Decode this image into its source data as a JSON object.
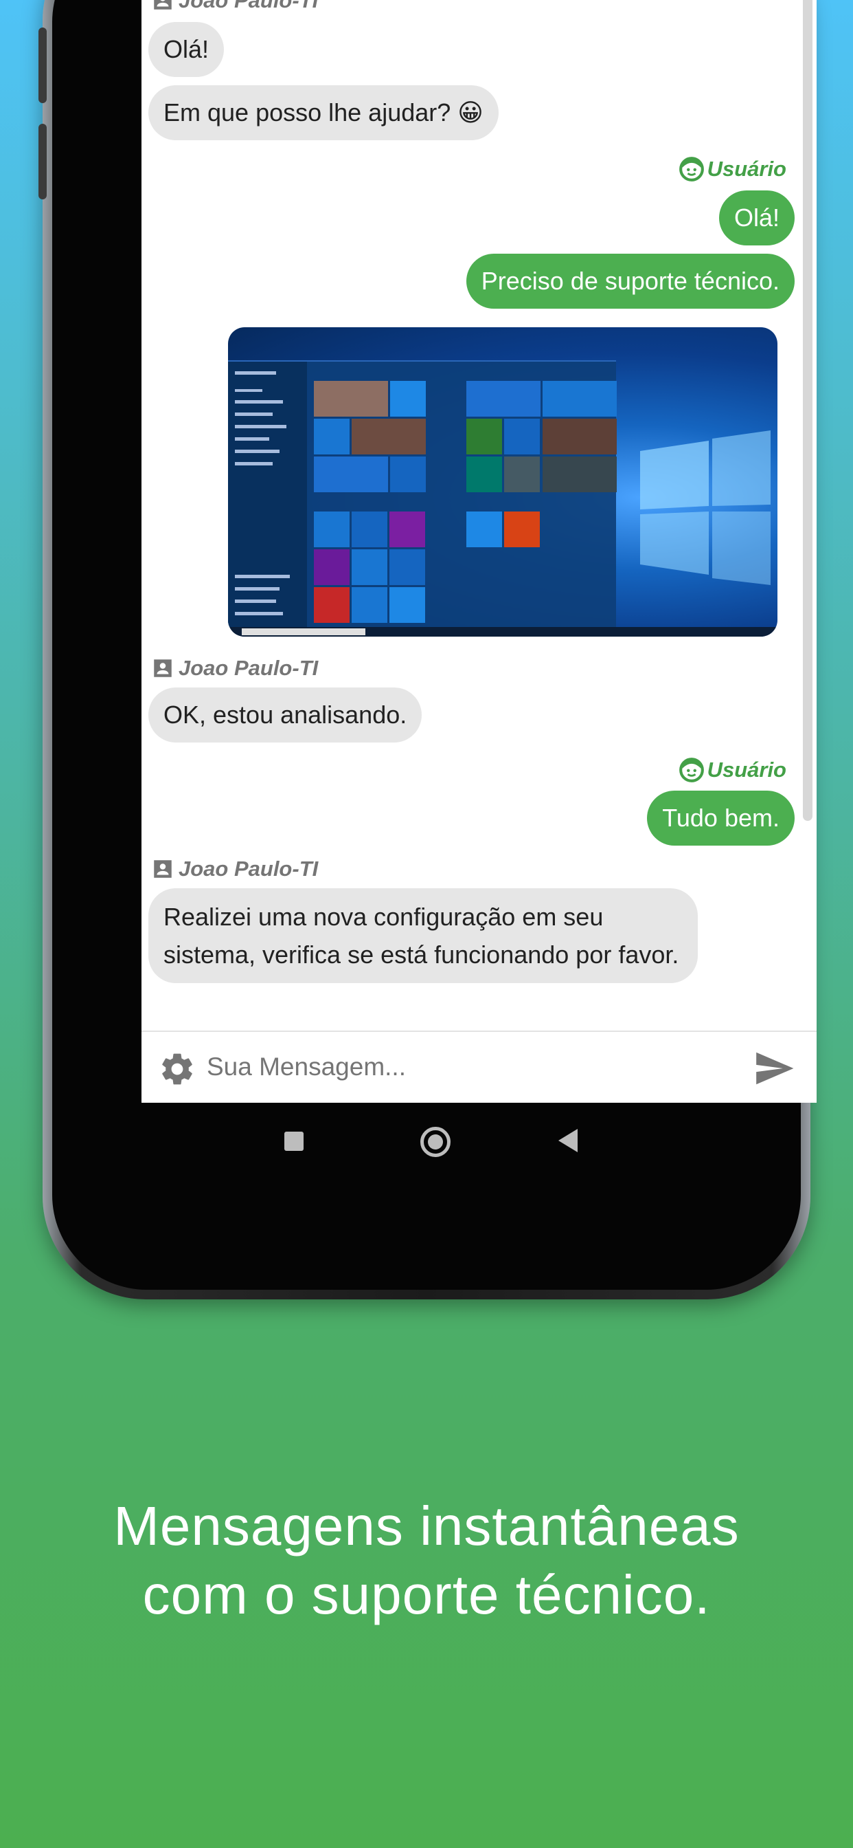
{
  "colors": {
    "accent_green": "#4caf50",
    "user_label_green": "#43a047",
    "incoming_bubble": "#e6e6e6",
    "sender_label_gray": "#757575"
  },
  "header": {
    "avatar_icon": "support-agent-avatar",
    "like_icon": "thumbs-up-icon",
    "dislike_icon": "thumbs-down-icon"
  },
  "messages": [
    {
      "type": "sender_label",
      "icon": "contact-card-icon",
      "name": "Joao Paulo-TI"
    },
    {
      "type": "incoming",
      "text": "Olá!"
    },
    {
      "type": "incoming",
      "text": "Em que posso lhe ajudar? 😀"
    },
    {
      "type": "user_label",
      "icon": "smiley-face-icon",
      "name": "Usuário"
    },
    {
      "type": "outgoing",
      "text": "Olá!"
    },
    {
      "type": "outgoing",
      "text": "Preciso de suporte técnico."
    },
    {
      "type": "image",
      "icon": "windows-desktop-screenshot"
    },
    {
      "type": "sender_label",
      "icon": "contact-card-icon",
      "name": "Joao Paulo-TI"
    },
    {
      "type": "incoming",
      "text": "OK, estou analisando."
    },
    {
      "type": "user_label",
      "icon": "smiley-face-icon",
      "name": "Usuário"
    },
    {
      "type": "outgoing",
      "text": "Tudo bem."
    },
    {
      "type": "sender_label",
      "icon": "contact-card-icon",
      "name": "Joao Paulo-TI"
    },
    {
      "type": "incoming",
      "text": "Realizei uma nova configuração em seu sistema, verifica se está funcionando por favor."
    }
  ],
  "input_bar": {
    "settings_icon": "gear-icon",
    "placeholder": "Sua Mensagem...",
    "send_icon": "send-icon"
  },
  "nav_bar": {
    "recents_icon": "square-icon",
    "home_icon": "circle-icon",
    "back_icon": "back-triangle-icon"
  },
  "caption": {
    "line1": "Mensagens instantâneas",
    "line2": "com o suporte técnico."
  }
}
